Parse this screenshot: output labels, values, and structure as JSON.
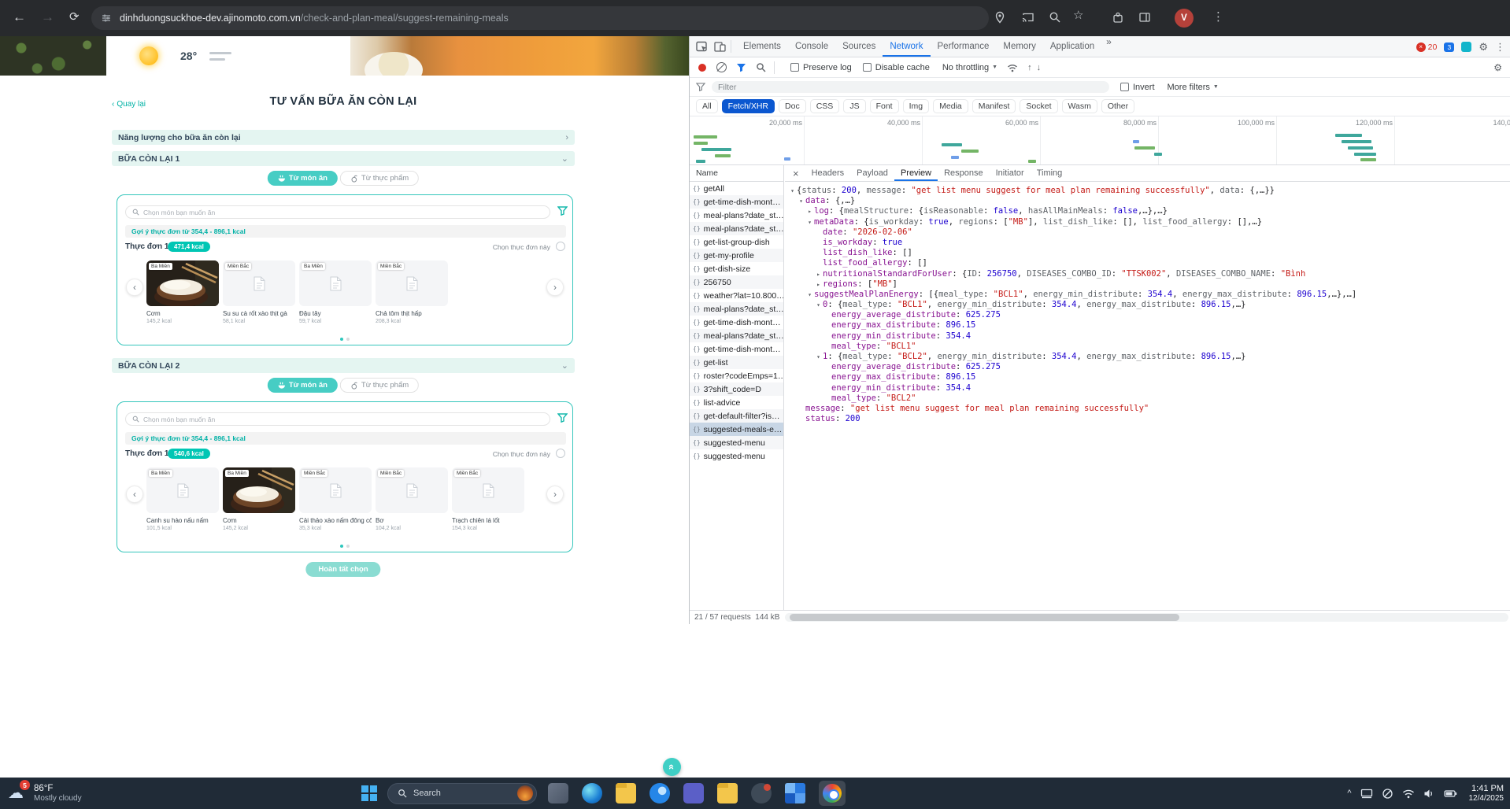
{
  "browser": {
    "domain": "dinhduongsuckhoe-dev.ajinomoto.com.vn",
    "path": "/check-and-plan-meal/suggest-remaining-meals",
    "avatar_letter": "V"
  },
  "banner": {
    "temperature": "28°"
  },
  "page": {
    "back_link": "Quay lại",
    "title": "TƯ VẤN BỮA ĂN CÒN LẠI",
    "energy_section_title": "Năng lượng cho bữa ăn còn lại",
    "finish_button": "Hoàn tất chọn",
    "meals": [
      {
        "section_title": "BỮA CÒN LẠI 1",
        "tab_dish": "Từ món ăn",
        "tab_food": "Từ thực phẩm",
        "search_placeholder": "Chọn món bạn muốn ăn",
        "suggestion_text": "Gợi ý thực đơn từ 354,4 - 896,1 kcal",
        "menu_label": "Thực đơn 1",
        "menu_kcal": "471,4 kcal",
        "choose_menu_label": "Chọn thực đơn này",
        "dishes": [
          {
            "region": "Ba Miền",
            "name": "Cơm",
            "kcal": "145,2 kcal",
            "image": "rice"
          },
          {
            "region": "Miền Bắc",
            "name": "Su su cà rốt xào thịt gà",
            "kcal": "58,1 kcal",
            "image": "placeholder"
          },
          {
            "region": "Ba Miền",
            "name": "Đậu tây",
            "kcal": "59,7 kcal",
            "image": "placeholder"
          },
          {
            "region": "Miền Bắc",
            "name": "Chả tôm thịt hấp",
            "kcal": "208,3 kcal",
            "image": "placeholder"
          }
        ]
      },
      {
        "section_title": "BỮA CÒN LẠI 2",
        "tab_dish": "Từ món ăn",
        "tab_food": "Từ thực phẩm",
        "search_placeholder": "Chọn món bạn muốn ăn",
        "suggestion_text": "Gợi ý thực đơn từ 354,4 - 896,1 kcal",
        "menu_label": "Thực đơn 1",
        "menu_kcal": "540,6 kcal",
        "choose_menu_label": "Chọn thực đơn này",
        "dishes": [
          {
            "region": "Ba Miền",
            "name": "Canh su hào nấu nấm",
            "kcal": "101,5 kcal",
            "image": "placeholder"
          },
          {
            "region": "Ba Miền",
            "name": "Cơm",
            "kcal": "145,2 kcal",
            "image": "rice"
          },
          {
            "region": "Miền Bắc",
            "name": "Cải thảo xào nấm đông cô",
            "kcal": "35,3 kcal",
            "image": "placeholder"
          },
          {
            "region": "Miền Bắc",
            "name": "Bơ",
            "kcal": "104,2 kcal",
            "image": "placeholder"
          },
          {
            "region": "Miền Bắc",
            "name": "Trạch chiên lá lốt",
            "kcal": "154,3 kcal",
            "image": "placeholder"
          }
        ]
      }
    ]
  },
  "devtools": {
    "tabs": [
      "Elements",
      "Console",
      "Sources",
      "Network",
      "Performance",
      "Memory",
      "Application"
    ],
    "active_tab": "Network",
    "error_count": "20",
    "issue_count": "3",
    "toolbar": {
      "preserve_log": "Preserve log",
      "disable_cache": "Disable cache",
      "throttling": "No throttling"
    },
    "filter_bar": {
      "placeholder": "Filter",
      "invert_label": "Invert",
      "more_filters_label": "More filters"
    },
    "type_filters": [
      "All",
      "Fetch/XHR",
      "Doc",
      "CSS",
      "JS",
      "Font",
      "Img",
      "Media",
      "Manifest",
      "Socket",
      "Wasm",
      "Other"
    ],
    "active_type_filter": "Fetch/XHR",
    "timeline_labels": [
      "20,000 ms",
      "40,000 ms",
      "60,000 ms",
      "80,000 ms",
      "100,000 ms",
      "120,000 ms",
      "140,0"
    ],
    "name_column_header": "Name",
    "requests": [
      {
        "name": "getAll"
      },
      {
        "name": "get-time-dish-mont…"
      },
      {
        "name": "meal-plans?date_st…"
      },
      {
        "name": "meal-plans?date_st…"
      },
      {
        "name": "get-list-group-dish"
      },
      {
        "name": "get-my-profile"
      },
      {
        "name": "get-dish-size"
      },
      {
        "name": "256750"
      },
      {
        "name": "weather?lat=10.800…"
      },
      {
        "name": "meal-plans?date_st…"
      },
      {
        "name": "get-time-dish-mont…"
      },
      {
        "name": "meal-plans?date_st…"
      },
      {
        "name": "get-time-dish-mont…"
      },
      {
        "name": "get-list"
      },
      {
        "name": "roster?codeEmps=1…"
      },
      {
        "name": "3?shift_code=D"
      },
      {
        "name": "list-advice"
      },
      {
        "name": "get-default-filter?is…"
      },
      {
        "name": "suggested-meals-e…",
        "selected": true
      },
      {
        "name": "suggested-menu"
      },
      {
        "name": "suggested-menu"
      }
    ],
    "detail_tabs": [
      "Headers",
      "Payload",
      "Preview",
      "Response",
      "Initiator",
      "Timing"
    ],
    "active_detail_tab": "Preview",
    "preview_lines": [
      {
        "i": 0,
        "a": "o",
        "s": [
          [
            "{",
            "p"
          ],
          [
            "status",
            "pk"
          ],
          [
            ": ",
            "p"
          ],
          [
            "200",
            "n"
          ],
          [
            ", ",
            "p"
          ],
          [
            "message",
            "pk"
          ],
          [
            ": ",
            "p"
          ],
          [
            "\"get list menu suggest for meal plan remaining successfully\"",
            "s"
          ],
          [
            ", ",
            "p"
          ],
          [
            "data",
            "pk"
          ],
          [
            ": ",
            "p"
          ],
          [
            "{,…}}",
            "p"
          ]
        ]
      },
      {
        "i": 1,
        "a": "o",
        "s": [
          [
            "data",
            "k"
          ],
          [
            ": ",
            "p"
          ],
          [
            "{,…}",
            "p"
          ]
        ]
      },
      {
        "i": 2,
        "a": "c",
        "s": [
          [
            "log",
            "k"
          ],
          [
            ": {",
            "p"
          ],
          [
            "mealStructure",
            "pk"
          ],
          [
            ": {",
            "p"
          ],
          [
            "isReasonable",
            "pk"
          ],
          [
            ": ",
            "p"
          ],
          [
            "false",
            "n"
          ],
          [
            ", ",
            "p"
          ],
          [
            "hasAllMainMeals",
            "pk"
          ],
          [
            ": ",
            "p"
          ],
          [
            "false",
            "n"
          ],
          [
            ",…},…}",
            "p"
          ]
        ]
      },
      {
        "i": 2,
        "a": "o",
        "s": [
          [
            "metaData",
            "k"
          ],
          [
            ": {",
            "p"
          ],
          [
            "is_workday",
            "pk"
          ],
          [
            ": ",
            "p"
          ],
          [
            "true",
            "n"
          ],
          [
            ", ",
            "p"
          ],
          [
            "regions",
            "pk"
          ],
          [
            ": [",
            "p"
          ],
          [
            "\"MB\"",
            "s"
          ],
          [
            "], ",
            "p"
          ],
          [
            "list_dish_like",
            "pk"
          ],
          [
            ": [], ",
            "p"
          ],
          [
            "list_food_allergy",
            "pk"
          ],
          [
            ": [],…}",
            "p"
          ]
        ]
      },
      {
        "i": 3,
        "a": "",
        "s": [
          [
            "date",
            "k"
          ],
          [
            ": ",
            "p"
          ],
          [
            "\"2026-02-06\"",
            "s"
          ]
        ]
      },
      {
        "i": 3,
        "a": "",
        "s": [
          [
            "is_workday",
            "k"
          ],
          [
            ": ",
            "p"
          ],
          [
            "true",
            "n"
          ]
        ]
      },
      {
        "i": 3,
        "a": "",
        "s": [
          [
            "list_dish_like",
            "k"
          ],
          [
            ": ",
            "p"
          ],
          [
            "[]",
            "p"
          ]
        ]
      },
      {
        "i": 3,
        "a": "",
        "s": [
          [
            "list_food_allergy",
            "k"
          ],
          [
            ": ",
            "p"
          ],
          [
            "[]",
            "p"
          ]
        ]
      },
      {
        "i": 3,
        "a": "c",
        "s": [
          [
            "nutritionalStandardForUser",
            "k"
          ],
          [
            ": {",
            "p"
          ],
          [
            "ID",
            "pk"
          ],
          [
            ": ",
            "p"
          ],
          [
            "256750",
            "n"
          ],
          [
            ", ",
            "p"
          ],
          [
            "DISEASES_COMBO_ID",
            "pk"
          ],
          [
            ": ",
            "p"
          ],
          [
            "\"TTSK002\"",
            "s"
          ],
          [
            ", ",
            "p"
          ],
          [
            "DISEASES_COMBO_NAME",
            "pk"
          ],
          [
            ": ",
            "p"
          ],
          [
            "\"Bình",
            "s"
          ]
        ]
      },
      {
        "i": 3,
        "a": "c",
        "s": [
          [
            "regions",
            "k"
          ],
          [
            ": ",
            "p"
          ],
          [
            "[",
            "p"
          ],
          [
            "\"MB\"",
            "s"
          ],
          [
            "]",
            "p"
          ]
        ]
      },
      {
        "i": 2,
        "a": "o",
        "s": [
          [
            "suggestMealPlanEnergy",
            "k"
          ],
          [
            ": [{",
            "p"
          ],
          [
            "meal_type",
            "pk"
          ],
          [
            ": ",
            "p"
          ],
          [
            "\"BCL1\"",
            "s"
          ],
          [
            ", ",
            "p"
          ],
          [
            "energy_min_distribute",
            "pk"
          ],
          [
            ": ",
            "p"
          ],
          [
            "354.4",
            "n"
          ],
          [
            ", ",
            "p"
          ],
          [
            "energy_max_distribute",
            "pk"
          ],
          [
            ": ",
            "p"
          ],
          [
            "896.15",
            "n"
          ],
          [
            ",…},…]",
            "p"
          ]
        ]
      },
      {
        "i": 3,
        "a": "o",
        "s": [
          [
            "0",
            "k"
          ],
          [
            ": {",
            "p"
          ],
          [
            "meal_type",
            "pk"
          ],
          [
            ": ",
            "p"
          ],
          [
            "\"BCL1\"",
            "s"
          ],
          [
            ", ",
            "p"
          ],
          [
            "energy_min_distribute",
            "pk"
          ],
          [
            ": ",
            "p"
          ],
          [
            "354.4",
            "n"
          ],
          [
            ", ",
            "p"
          ],
          [
            "energy_max_distribute",
            "pk"
          ],
          [
            ": ",
            "p"
          ],
          [
            "896.15",
            "n"
          ],
          [
            ",…}",
            "p"
          ]
        ]
      },
      {
        "i": 4,
        "a": "",
        "s": [
          [
            "energy_average_distribute",
            "k"
          ],
          [
            ": ",
            "p"
          ],
          [
            "625.275",
            "n"
          ]
        ]
      },
      {
        "i": 4,
        "a": "",
        "s": [
          [
            "energy_max_distribute",
            "k"
          ],
          [
            ": ",
            "p"
          ],
          [
            "896.15",
            "n"
          ]
        ]
      },
      {
        "i": 4,
        "a": "",
        "s": [
          [
            "energy_min_distribute",
            "k"
          ],
          [
            ": ",
            "p"
          ],
          [
            "354.4",
            "n"
          ]
        ]
      },
      {
        "i": 4,
        "a": "",
        "s": [
          [
            "meal_type",
            "k"
          ],
          [
            ": ",
            "p"
          ],
          [
            "\"BCL1\"",
            "s"
          ]
        ]
      },
      {
        "i": 3,
        "a": "o",
        "s": [
          [
            "1",
            "k"
          ],
          [
            ": {",
            "p"
          ],
          [
            "meal_type",
            "pk"
          ],
          [
            ": ",
            "p"
          ],
          [
            "\"BCL2\"",
            "s"
          ],
          [
            ", ",
            "p"
          ],
          [
            "energy_min_distribute",
            "pk"
          ],
          [
            ": ",
            "p"
          ],
          [
            "354.4",
            "n"
          ],
          [
            ", ",
            "p"
          ],
          [
            "energy_max_distribute",
            "pk"
          ],
          [
            ": ",
            "p"
          ],
          [
            "896.15",
            "n"
          ],
          [
            ",…}",
            "p"
          ]
        ]
      },
      {
        "i": 4,
        "a": "",
        "s": [
          [
            "energy_average_distribute",
            "k"
          ],
          [
            ": ",
            "p"
          ],
          [
            "625.275",
            "n"
          ]
        ]
      },
      {
        "i": 4,
        "a": "",
        "s": [
          [
            "energy_max_distribute",
            "k"
          ],
          [
            ": ",
            "p"
          ],
          [
            "896.15",
            "n"
          ]
        ]
      },
      {
        "i": 4,
        "a": "",
        "s": [
          [
            "energy_min_distribute",
            "k"
          ],
          [
            ": ",
            "p"
          ],
          [
            "354.4",
            "n"
          ]
        ]
      },
      {
        "i": 4,
        "a": "",
        "s": [
          [
            "meal_type",
            "k"
          ],
          [
            ": ",
            "p"
          ],
          [
            "\"BCL2\"",
            "s"
          ]
        ]
      },
      {
        "i": 1,
        "a": "",
        "s": [
          [
            "message",
            "k"
          ],
          [
            ": ",
            "p"
          ],
          [
            "\"get list menu suggest for meal plan remaining successfully\"",
            "s"
          ]
        ]
      },
      {
        "i": 1,
        "a": "",
        "s": [
          [
            "status",
            "k"
          ],
          [
            ": ",
            "p"
          ],
          [
            "200",
            "n"
          ]
        ]
      }
    ],
    "status_requests": "21 / 57 requests",
    "status_transferred": "144 kB"
  },
  "taskbar": {
    "weather_badge": "5",
    "weather_temp": "86°F",
    "weather_desc": "Mostly cloudy",
    "search_placeholder": "Search",
    "clock_time": "1:41 PM",
    "clock_date": "12/4/2025"
  }
}
